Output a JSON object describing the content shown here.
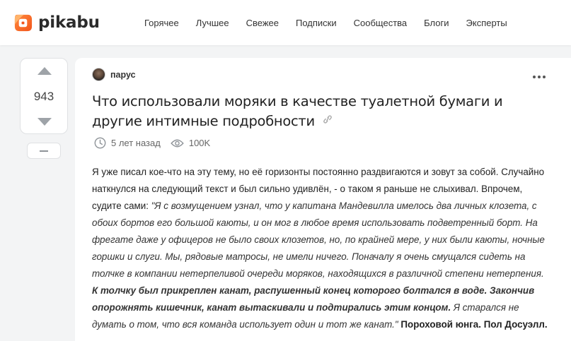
{
  "brand": {
    "name": "pikabu",
    "accent": "#ff6a2b"
  },
  "nav": [
    "Горячее",
    "Лучшее",
    "Свежее",
    "Подписки",
    "Сообщества",
    "Блоги",
    "Эксперты"
  ],
  "vote": {
    "count": "943"
  },
  "post": {
    "author": "парус",
    "title": "Что использовали моряки в качестве туалетной бумаги и другие интимные подробности",
    "time": "5 лет назад",
    "views": "100K",
    "body": {
      "intro": "Я уже писал кое-что на эту тему, но её горизонты постоянно раздвигаются и зовут за собой. Случайно наткнулся на следующий текст и был сильно удивлён, - о таком я раньше не слыхивал. Впрочем, судите сами: ",
      "quote1": "\"Я с возмущением узнал, что у капитана Мандевилла имелось два личных клозета, с обоих бортов его большой каюты, и он мог в любое время использовать подветренный борт. На фрегате даже у офицеров не было своих клозетов, но, по крайней мере, у них были каюты, ночные горшки и слуги. Мы, рядовые матросы, не имели ничего. Поначалу я очень смущался сидеть на толчке в компании нетерпеливой очереди моряков, находящихся в различной степени нетерпения. ",
      "bold1": "К толчку был прикреплен канат, распушенный конец которого болтался в воде. Закончив опорожнять кишечник, канат вытаскивали и подтирались этим концом.",
      "quote2": " Я старался не думать о том, что вся команда использует один и тот же канат.\"",
      "source": " Пороховой юнга. Пол Досуэлл."
    }
  }
}
